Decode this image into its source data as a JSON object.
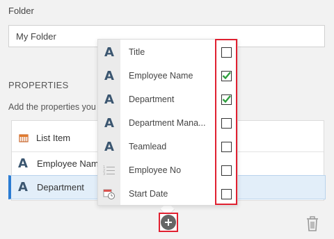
{
  "folder": {
    "label": "Folder",
    "value": "My Folder"
  },
  "properties": {
    "title": "PROPERTIES",
    "description": "Add the properties you",
    "header_label": "List Item",
    "rows": [
      {
        "label": "Employee Name",
        "icon": "text-icon"
      },
      {
        "label": "Department",
        "icon": "text-icon",
        "selected": true
      }
    ]
  },
  "popup": {
    "items": [
      {
        "label": "Title",
        "icon": "text-icon",
        "checked": false
      },
      {
        "label": "Employee Name",
        "icon": "text-icon",
        "checked": true
      },
      {
        "label": "Department",
        "icon": "text-icon",
        "checked": true
      },
      {
        "label": "Department Mana...",
        "icon": "text-icon",
        "checked": false
      },
      {
        "label": "Teamlead",
        "icon": "text-icon",
        "checked": false
      },
      {
        "label": "Employee No",
        "icon": "numbered-list-icon",
        "checked": false
      },
      {
        "label": "Start Date",
        "icon": "calendar-clock-icon",
        "checked": false
      }
    ]
  },
  "colors": {
    "highlight": "#e02030",
    "check": "#2e9e3e",
    "selected_bar": "#2b7cd3",
    "text_icon": "#3b5670"
  }
}
